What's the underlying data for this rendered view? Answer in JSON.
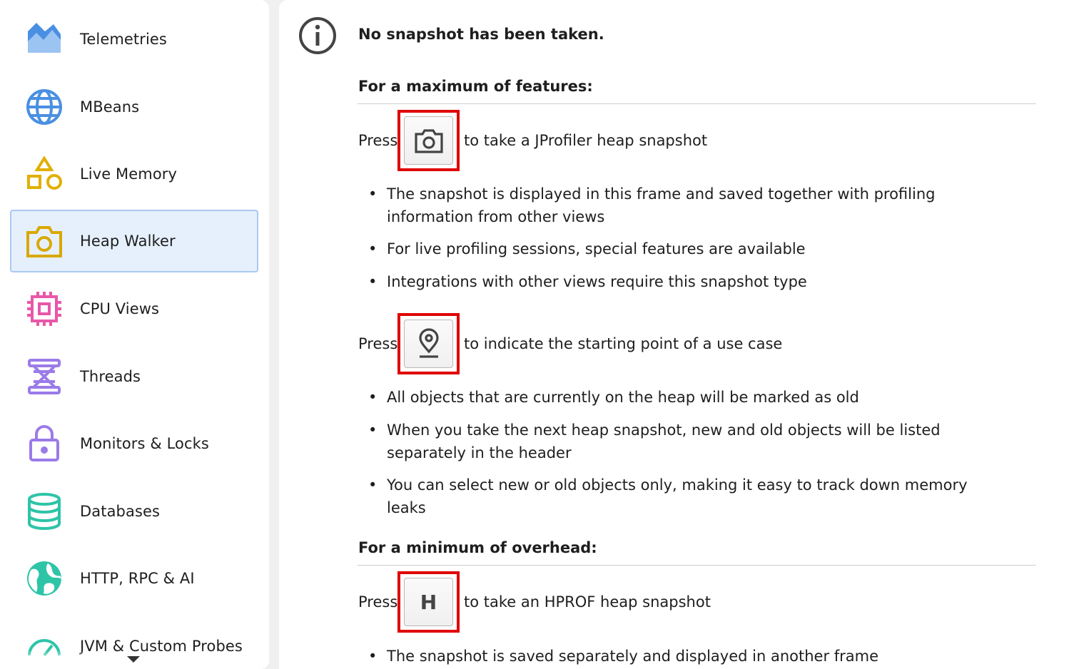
{
  "sidebar": {
    "items": [
      {
        "label": "Telemetries",
        "icon": "telemetries-icon",
        "color": "#4a90e2"
      },
      {
        "label": "MBeans",
        "icon": "globe-icon",
        "color": "#4a90e2"
      },
      {
        "label": "Live Memory",
        "icon": "shapes-icon",
        "color": "#e0b000"
      },
      {
        "label": "Heap Walker",
        "icon": "camera-icon",
        "color": "#d9a800",
        "selected": true
      },
      {
        "label": "CPU Views",
        "icon": "chip-icon",
        "color": "#e858a8"
      },
      {
        "label": "Threads",
        "icon": "spool-icon",
        "color": "#9b7be8"
      },
      {
        "label": "Monitors & Locks",
        "icon": "lock-icon",
        "color": "#9b7be8"
      },
      {
        "label": "Databases",
        "icon": "database-icon",
        "color": "#2ec4a8"
      },
      {
        "label": "HTTP, RPC & AI",
        "icon": "planet-icon",
        "color": "#2ec4a8"
      },
      {
        "label": "JVM & Custom Probes",
        "icon": "gauge-icon",
        "color": "#2ec4a8"
      }
    ]
  },
  "main": {
    "title": "No snapshot has been taken.",
    "sections": [
      {
        "heading": "For a maximum of features:",
        "actions": [
          {
            "press": "Press",
            "button_icon": "camera-icon",
            "text": "to take a JProfiler heap snapshot",
            "bullets": [
              "The snapshot is displayed in this frame and saved together with profiling information from other views",
              "For live profiling sessions, special features are available",
              "Integrations with other views require this snapshot type"
            ]
          },
          {
            "press": "Press",
            "button_icon": "location-pin-icon",
            "text": "to indicate the starting point of a use case",
            "bullets": [
              "All objects that are currently on the heap will be marked as old",
              "When you take the next heap snapshot, new and old objects will be listed separately in the header",
              "You can select new or old objects only, making it easy to track down memory leaks"
            ]
          }
        ]
      },
      {
        "heading": "For a minimum of overhead:",
        "actions": [
          {
            "press": "Press",
            "button_key": "H",
            "text": "to take an HPROF heap snapshot",
            "bullets": [
              "The snapshot is saved separately and displayed in another frame"
            ]
          }
        ]
      }
    ]
  },
  "bullet_char": "•"
}
